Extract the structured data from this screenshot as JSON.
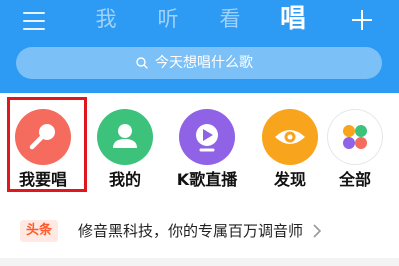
{
  "header": {
    "tabs": [
      {
        "label": "我",
        "active": false
      },
      {
        "label": "听",
        "active": false
      },
      {
        "label": "看",
        "active": false
      },
      {
        "label": "唱",
        "active": true
      }
    ],
    "menu_icon": "menu-icon",
    "add_icon": "plus-icon",
    "background_color": "#2d9af3"
  },
  "search": {
    "placeholder": "今天想唱什么歌",
    "icon": "search-icon"
  },
  "entries": [
    {
      "label": "我要唱",
      "icon": "microphone-icon",
      "color": "#f56b5e",
      "highlighted": true
    },
    {
      "label": "我的",
      "icon": "user-icon",
      "color": "#3cc27a",
      "highlighted": false
    },
    {
      "label": "K歌直播",
      "icon": "live-broadcast-icon",
      "color": "#8f62e6",
      "highlighted": false
    },
    {
      "label": "发现",
      "icon": "eye-icon",
      "color": "#f8a41c",
      "highlighted": false
    },
    {
      "label": "全部",
      "icon": "grid-apps-icon",
      "color": "#ffffff",
      "highlighted": false
    }
  ],
  "headline": {
    "badge": "头条",
    "text": "修音黑科技，你的专属百万调音师",
    "arrow_icon": "chevron-right-icon"
  }
}
